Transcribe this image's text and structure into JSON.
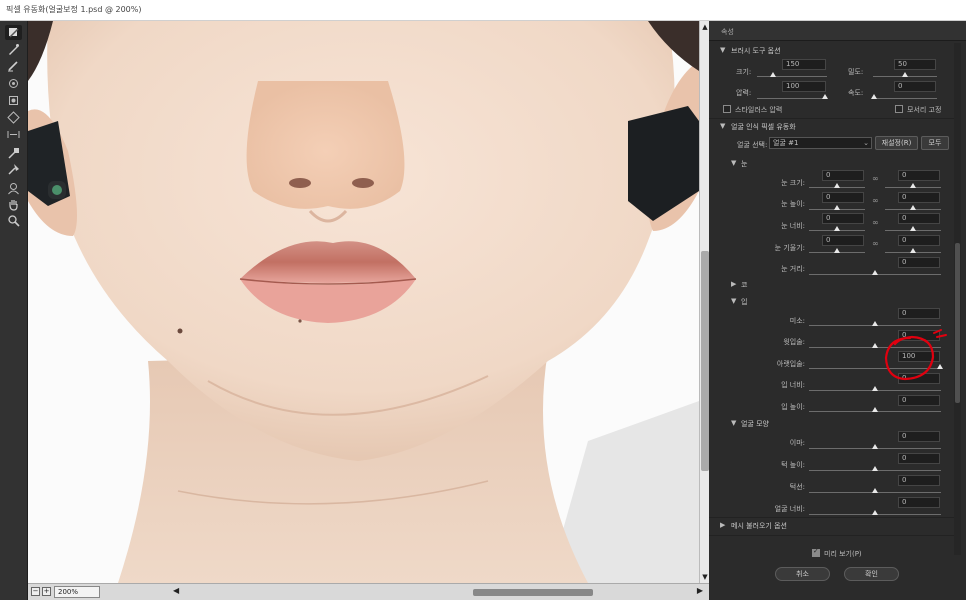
{
  "window": {
    "title": "픽셀 유동화(얼굴보정 1.psd @ 200%)"
  },
  "toolbar": {
    "tools": [
      {
        "name": "forward-warp-tool-icon",
        "active": true
      },
      {
        "name": "reconstruct-tool-icon"
      },
      {
        "name": "smooth-tool-icon"
      },
      {
        "name": "twirl-tool-icon"
      },
      {
        "name": "pucker-tool-icon"
      },
      {
        "name": "bloat-tool-icon"
      },
      {
        "name": "push-left-tool-icon"
      },
      {
        "name": "freeze-mask-tool-icon"
      },
      {
        "name": "thaw-mask-tool-icon"
      },
      {
        "name": "face-tool-icon"
      },
      {
        "name": "hand-tool-icon"
      },
      {
        "name": "zoom-tool-icon"
      }
    ]
  },
  "status": {
    "zoom": "200%"
  },
  "panel": {
    "header": "속성",
    "brush": {
      "title": "브러시 도구 옵션",
      "size_label": "크기:",
      "size_value": "150",
      "density_label": "밀도:",
      "density_value": "50",
      "pressure_label": "압력:",
      "pressure_value": "100",
      "rate_label": "속도:",
      "rate_value": "0",
      "stylus_label": "스타일러스 압력",
      "pin_edges_label": "모서리 고정"
    },
    "face": {
      "title": "얼굴 인식 픽셀 유동화",
      "select_label": "얼굴 선택:",
      "select_value": "얼굴 #1",
      "reset_label": "재설정(R)",
      "all_label": "모두",
      "eyes": {
        "title": "눈",
        "size_label": "눈 크기:",
        "size_l": "0",
        "size_r": "0",
        "height_label": "눈 높이:",
        "height_l": "0",
        "height_r": "0",
        "width_label": "눈 너비:",
        "width_l": "0",
        "width_r": "0",
        "tilt_label": "눈 기울기:",
        "tilt_l": "0",
        "tilt_r": "0",
        "distance_label": "눈 거리:",
        "distance_value": "0"
      },
      "nose": {
        "title": "코"
      },
      "mouth": {
        "title": "입",
        "smile_label": "미소:",
        "smile_value": "0",
        "upper_lip_label": "윗입술:",
        "upper_lip_value": "0",
        "lower_lip_label": "아랫입술:",
        "lower_lip_value": "100",
        "width_label": "입 너비:",
        "width_value": "0",
        "height_label": "입 높이:",
        "height_value": "0"
      },
      "shape": {
        "title": "얼굴 모양",
        "forehead_label": "이마:",
        "forehead_value": "0",
        "chin_label": "턱 높이:",
        "chin_value": "0",
        "jaw_label": "턱선:",
        "jaw_value": "0",
        "width_label": "얼굴 너비:",
        "width_value": "0"
      }
    },
    "mesh": {
      "title": "메시 불러오기 옵션"
    },
    "preview_label": "미리 보기(P)",
    "cancel_label": "취소",
    "ok_label": "확인"
  },
  "colors": {
    "panel_bg": "#2b2b2b",
    "annotation": "#e0000f",
    "skin": "#f4e2d4"
  }
}
